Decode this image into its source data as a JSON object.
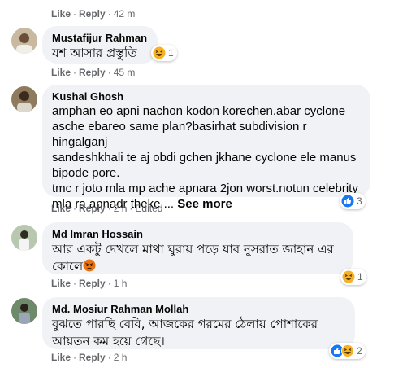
{
  "comments": [
    {
      "actions": {
        "like": "Like",
        "reply": "Reply",
        "time": "42 m"
      }
    },
    {
      "author": "Mustafijur Rahman",
      "text": "যশ আসার প্রস্তুতি",
      "reactions": {
        "icons": [
          "haha-icon"
        ],
        "count": "1"
      },
      "actions": {
        "like": "Like",
        "reply": "Reply",
        "time": "45 m"
      }
    },
    {
      "author": "Kushal Ghosh",
      "text": "amphan eo apni nachon kodon korechen.abar cyclone\nasche ebareo same plan?basirhat subdivision r hingalganj\nsandeshkhali te aj obdi gchen jkhane cyclone ele manus\nbipode pore.\ntmc r joto mla mp ache apnara 2jon worst.notun celebrity\nmla ra apnadr theke ...",
      "see_more": "See more",
      "reactions": {
        "icons": [
          "like-icon"
        ],
        "count": "3"
      },
      "actions": {
        "like": "Like",
        "reply": "Reply",
        "time": "2 h",
        "edited": "Edited"
      }
    },
    {
      "author": "Md Imran Hossain",
      "text": "আর একটু দেখলে মাথা ঘুরায় পড়ে যাব নুসরাত জাহান এর\nকোলে",
      "reactions": {
        "icons": [
          "haha-icon"
        ],
        "count": "1"
      },
      "actions": {
        "like": "Like",
        "reply": "Reply",
        "time": "1 h"
      }
    },
    {
      "author": "Md. Mosiur Rahman Mollah",
      "text": "বুঝতে পারছি বেবি, আজকের গরমের ঠেলায় পোশাকের\nআয়তন কম হয়ে গেছে।",
      "reactions": {
        "icons": [
          "like-icon",
          "haha-icon"
        ],
        "count": "2"
      },
      "actions": {
        "like": "Like",
        "reply": "Reply",
        "time": "2 h"
      }
    }
  ],
  "colors": {
    "bubble": "#f0f2f5",
    "meta": "#65676b",
    "like_blue": "#1877f2",
    "haha_yellow": "#f7b125"
  }
}
